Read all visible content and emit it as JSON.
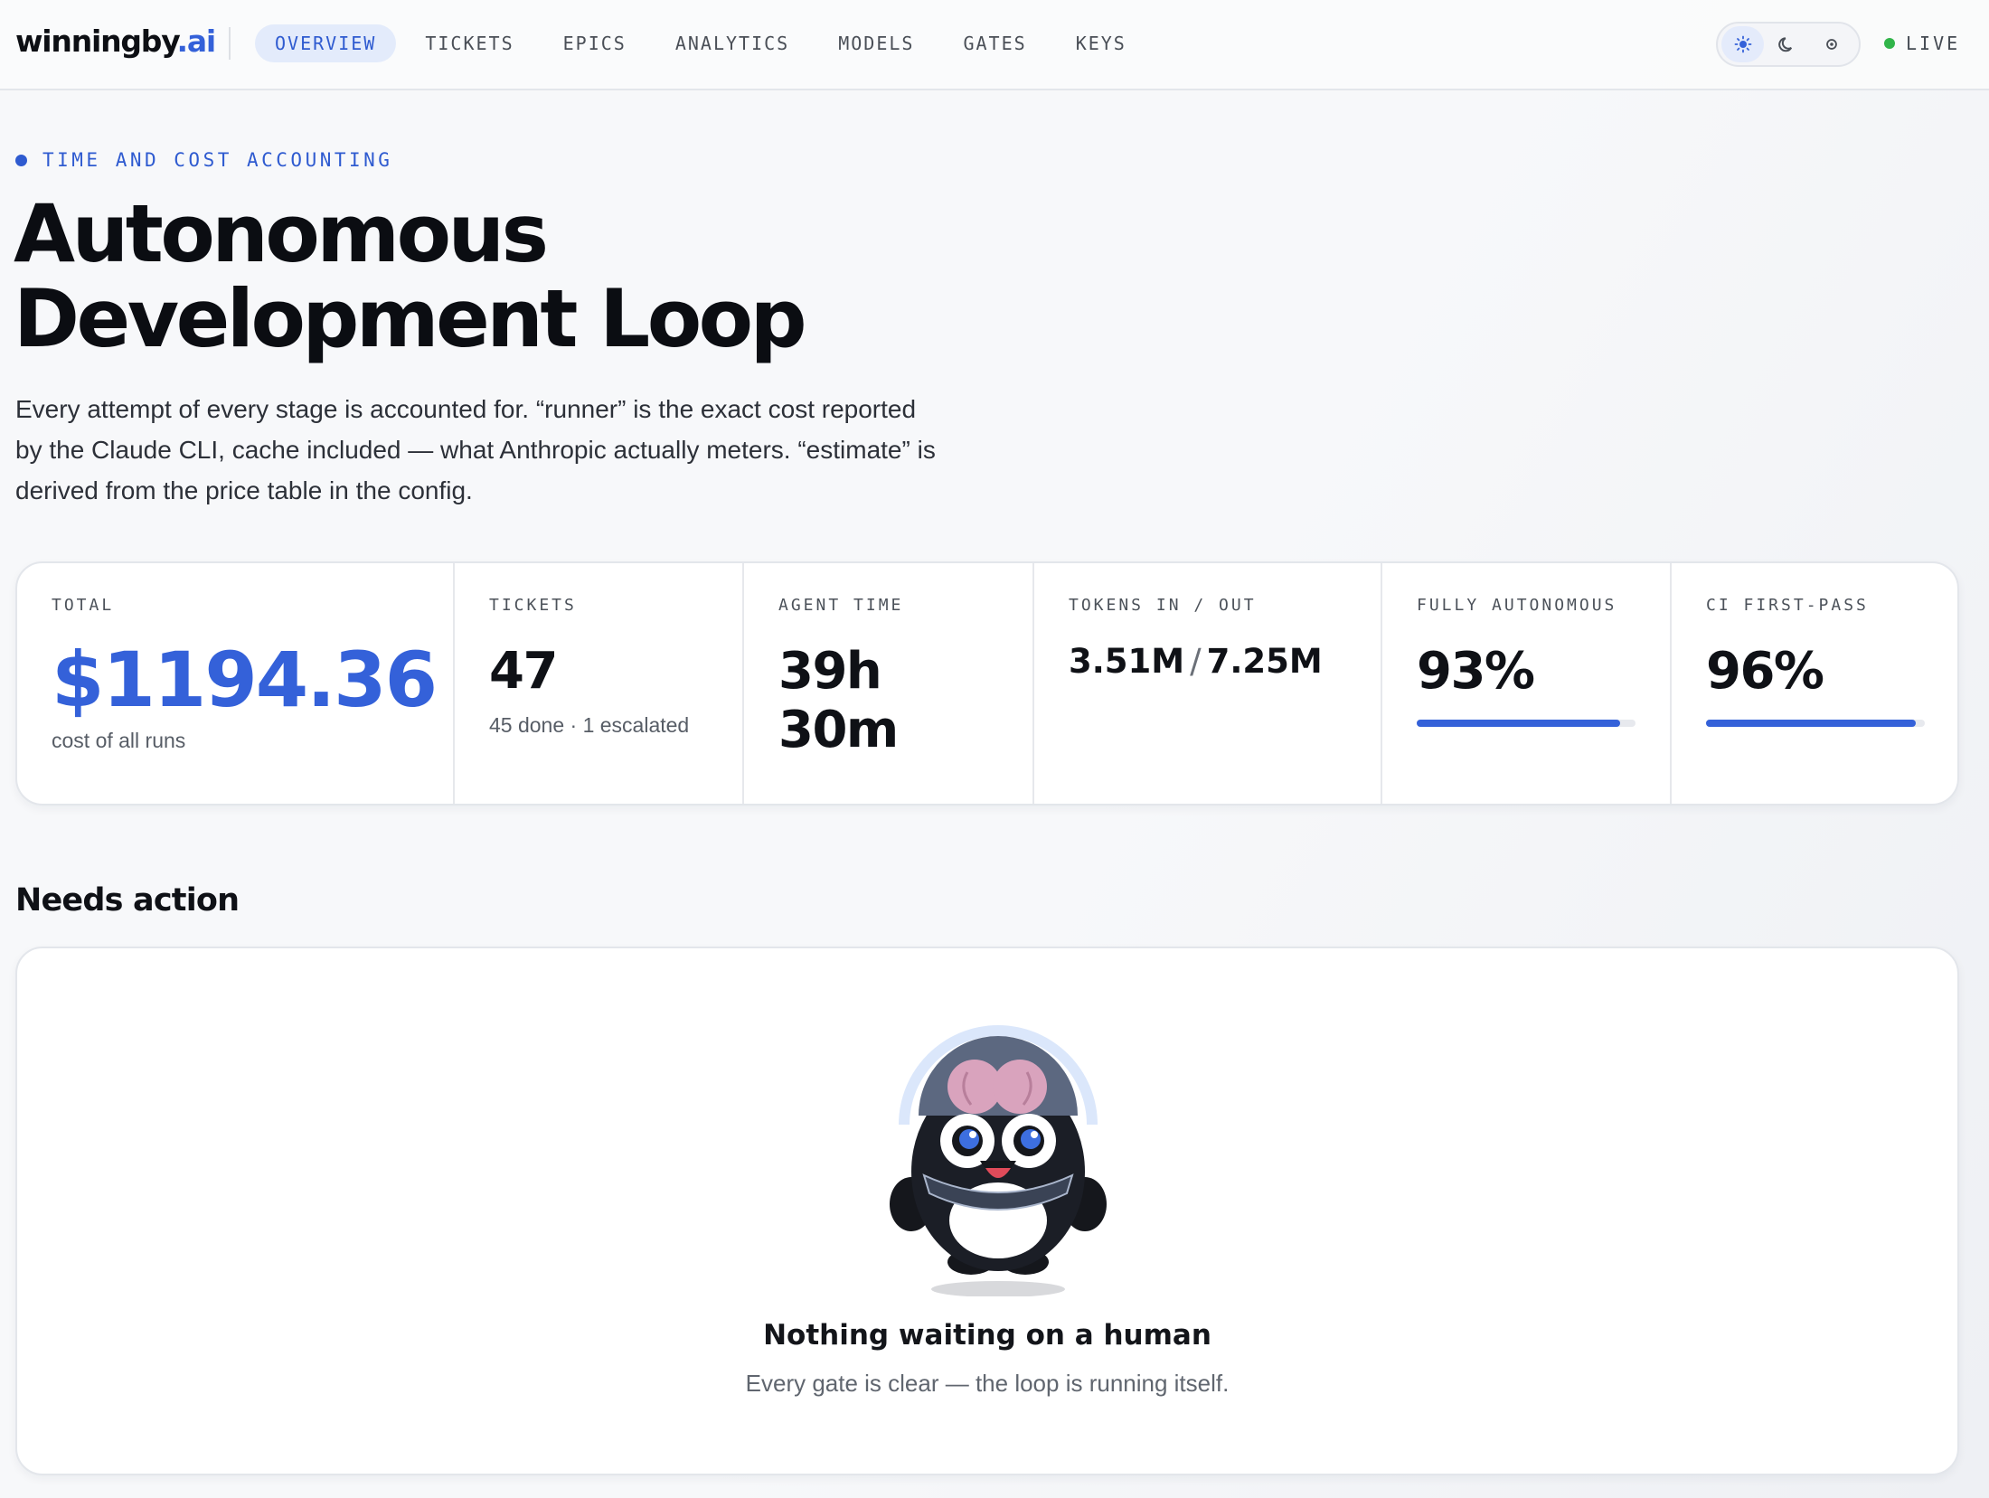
{
  "brand": {
    "name": "winningby",
    "accent": ".ai"
  },
  "nav": {
    "items": [
      {
        "label": "OVERVIEW",
        "active": true
      },
      {
        "label": "TICKETS",
        "active": false
      },
      {
        "label": "EPICS",
        "active": false
      },
      {
        "label": "ANALYTICS",
        "active": false
      },
      {
        "label": "MODELS",
        "active": false
      },
      {
        "label": "GATES",
        "active": false
      },
      {
        "label": "KEYS",
        "active": false
      }
    ]
  },
  "theme": {
    "options": [
      "sun-icon",
      "moon-icon",
      "gear-icon"
    ],
    "selected": "sun-icon"
  },
  "status": {
    "label": "LIVE",
    "color": "#31b54a"
  },
  "hero": {
    "eyebrow": "TIME AND COST ACCOUNTING",
    "title_line1": "Autonomous",
    "title_line2": "Development Loop",
    "subtitle": "Every attempt of every stage is accounted for. “runner” is the exact cost reported by the Claude CLI, cache included — what Anthropic actually meters. “estimate” is derived from the price table in the config."
  },
  "stats": {
    "total": {
      "label": "TOTAL",
      "value": "$1194.36",
      "sub": "cost of all runs"
    },
    "tickets": {
      "label": "TICKETS",
      "value": "47",
      "sub": "45 done · 1 escalated"
    },
    "agent_time": {
      "label": "AGENT TIME",
      "value": "39h 30m"
    },
    "tokens": {
      "label": "TOKENS IN / OUT",
      "in": "3.51M",
      "sep": "/",
      "out": "7.25M"
    },
    "autonomous": {
      "label": "FULLY AUTONOMOUS",
      "value": "93%",
      "fraction": 0.93
    },
    "ci": {
      "label": "CI FIRST-PASS",
      "value": "96%",
      "fraction": 0.96
    }
  },
  "needs_action": {
    "title": "Needs action",
    "empty_title": "Nothing waiting on a human",
    "empty_sub": "Every gate is clear — the loop is running itself."
  },
  "colors": {
    "accent": "#3461d9",
    "text": "#111318",
    "live": "#31b54a"
  }
}
